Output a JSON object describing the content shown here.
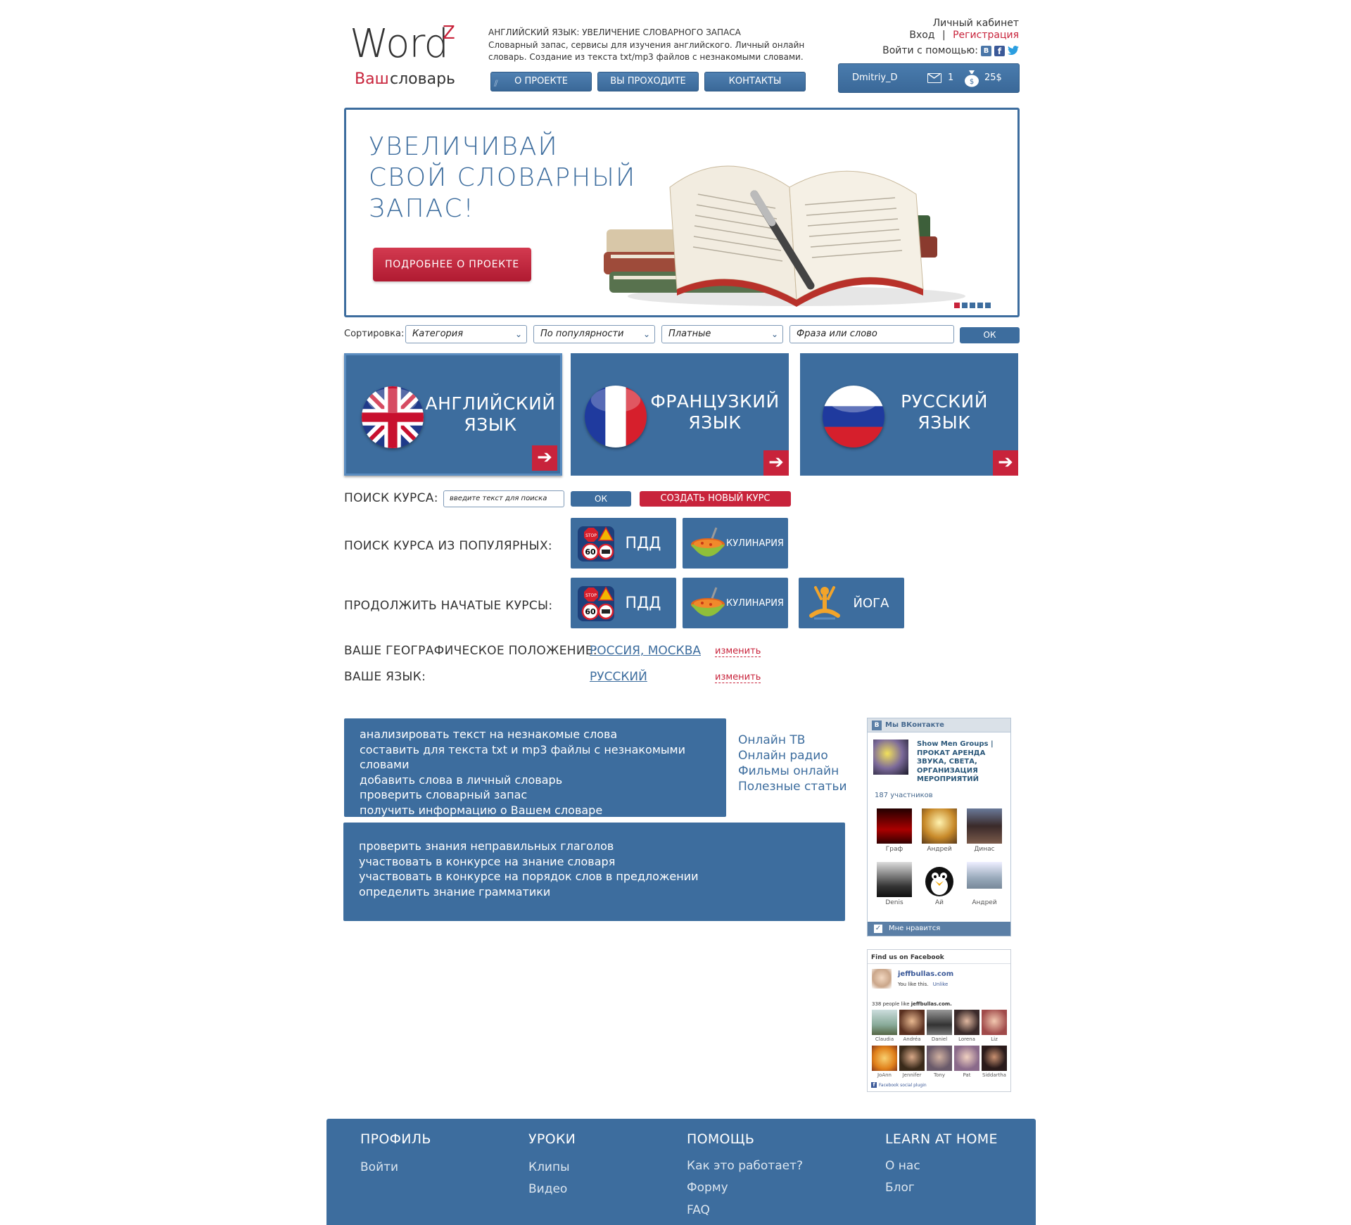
{
  "header": {
    "logo_word": "Word",
    "logo_sup": "Z",
    "logo_your": "Ваш",
    "logo_dict": "словарь",
    "headline": "АНГЛИЙСКИЙ ЯЗЫК: УВЕЛИЧЕНИЕ СЛОВАРНОГО ЗАПАСА",
    "desc_line1": "Словарный запас, сервисы для изучения английского. Личный онлайн",
    "desc_line2": "словарь. Создание из текста txt/mp3 файлов с незнакомыми словами.",
    "nav": [
      "О ПРОЕКТЕ",
      "ВЫ ПРОХОДИТЕ",
      "КОНТАКТЫ"
    ],
    "account_title": "Личный кабинет",
    "login": "Вход",
    "separator": "|",
    "register": "Регистрация",
    "login_with": "Войти с помощью:",
    "user": {
      "name": "Dmitriy_D",
      "messages": "1",
      "balance": "25$"
    }
  },
  "hero": {
    "line1": "УВЕЛИЧИВАЙ",
    "line2": "СВОЙ СЛОВАРНЫЙ",
    "line3": "ЗАПАС!",
    "button": "ПОДРОБНЕЕ О ПРОЕКТЕ",
    "slides": 5,
    "active_slide": 1
  },
  "filters": {
    "label": "Сортировка:",
    "category": "Категория",
    "popularity": "По популярности",
    "paid": "Платные",
    "search_placeholder": "Фраза или слово",
    "ok": "ОК"
  },
  "languages": [
    {
      "line1": "АНГЛИЙСКИЙ",
      "line2": "ЯЗЫК"
    },
    {
      "line1": "ФРАНЦУЗКИЙ",
      "line2": "ЯЗЫК"
    },
    {
      "line1": "РУССКИЙ",
      "line2": "ЯЗЫК"
    }
  ],
  "course_search": {
    "label": "ПОИСК КУРСА:",
    "placeholder": "введите текст для поиска",
    "ok": "ОК",
    "create": "СОЗДАТЬ НОВЫЙ КУРС"
  },
  "popular": {
    "label": "ПОИСК КУРСА ИЗ ПОПУЛЯРНЫХ:",
    "items": [
      "ПДД",
      "КУЛИНАРИЯ"
    ]
  },
  "continue": {
    "label": "ПРОДОЛЖИТЬ НАЧАТЫЕ КУРСЫ:",
    "items": [
      "ПДД",
      "КУЛИНАРИЯ",
      "ЙОГА"
    ]
  },
  "location": {
    "label": "ВАШЕ ГЕОГРАФИЧЕСКОЕ ПОЛОЖЕНИЕ:",
    "value": "РОССИЯ, МОСКВА",
    "change": "изменить"
  },
  "language": {
    "label": "ВАШЕ ЯЗЫК:",
    "value": "РУССКИЙ",
    "change": "изменить"
  },
  "features1": [
    "анализировать текст на незнакомые слова",
    "составить для текста txt и mp3 файлы с незнакомыми словами",
    "добавить слова в личный словарь",
    "проверить словарный запас",
    "получить информацию о Вашем словаре"
  ],
  "features2": [
    "проверить знания неправильных глаголов",
    "участвовать в конкурсе на знание словаря",
    "участвовать в конкурсе на порядок слов в предложении",
    "определить знание грамматики"
  ],
  "side_links": [
    "Онлайн ТВ",
    "Онлайн радио",
    "Фильмы онлайн",
    "Полезные статьи"
  ],
  "vk": {
    "title": "Мы ВКонтакте",
    "group_line1": "Show Men Groups |",
    "group_line2": "ПРОКАТ АРЕНДА",
    "group_line3": "ЗВУКА, СВЕТА,",
    "group_line4": "ОРГАНИЗАЦИЯ",
    "group_line5": "МЕРОПРИЯТИЙ",
    "members": "187 участников",
    "people": [
      "Граф",
      "Андрей",
      "Динас",
      "Denis",
      "Ай",
      "Андрей"
    ],
    "like": "Мне нравится"
  },
  "fb": {
    "title": "Find us on Facebook",
    "page": "jeffbullas.com",
    "you_like": "You like this.",
    "unlike": "Unlike",
    "count_pre": "338 people like ",
    "count_page": "jeffbullas.com.",
    "people": [
      "Claudia",
      "Andréa",
      "Daniel",
      "Lorena",
      "Liz",
      "JoAnn",
      "Jennifer",
      "Tony",
      "Pat",
      "Siddartha"
    ],
    "plugin": "Facebook social plugin"
  },
  "footer": {
    "cols": [
      {
        "title": "ПРОФИЛЬ",
        "links": [
          "Войти"
        ]
      },
      {
        "title": "УРОКИ",
        "links": [
          "Клипы",
          "Видео"
        ]
      },
      {
        "title": "ПОМОЩЬ",
        "links": [
          "Как это работает?",
          "Форму",
          "FAQ"
        ]
      },
      {
        "title": "LEARN AT HOME",
        "links": [
          "О нас",
          "Блог"
        ]
      }
    ]
  },
  "colors": {
    "accent_blue": "#3d6d9e",
    "accent_red": "#c8233b"
  }
}
